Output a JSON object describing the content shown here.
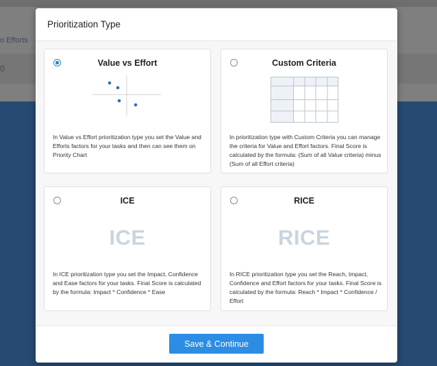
{
  "background": {
    "efforts_fragment": "o Efforts",
    "value_fragment": "0"
  },
  "modal": {
    "title": "Prioritization Type",
    "options": [
      {
        "title": "Value vs Effort",
        "selected": true,
        "illustration": "scatter-quadrant-icon",
        "description": "In Value vs Effort prioritization type you set the Value and Efforts factors for your tasks and then can see them on Priority Chart"
      },
      {
        "title": "Custom Criteria",
        "selected": false,
        "illustration": "grid-table-icon",
        "description": "In prioritization type with Custom Criteria you can manage the criteria for Value and Effort factors. Final Score is calculated by the formula: (Sum of all Value criteria) minus (Sum of all Effort criteria)"
      },
      {
        "title": "ICE",
        "selected": false,
        "big_word": "ICE",
        "description": "In ICE prioritization type you set the Impact, Confidence and Ease factors for your tasks. Final Score is calculated by the formula: Impact * Confidence * Ease"
      },
      {
        "title": "RICE",
        "selected": false,
        "big_word": "RICE",
        "description": "In RICE prioritization type you set the Reach, Impact, Confidence and Effort factors for your tasks. Final Score is calculated by the formula: Reach * Impact * Confidence / Effort"
      }
    ],
    "save_label": "Save & Continue"
  },
  "colors": {
    "accent": "#2b8de4",
    "radio_selected": "#2b86c8",
    "backdrop_blue": "#264a72",
    "big_word": "#c9d5df"
  }
}
